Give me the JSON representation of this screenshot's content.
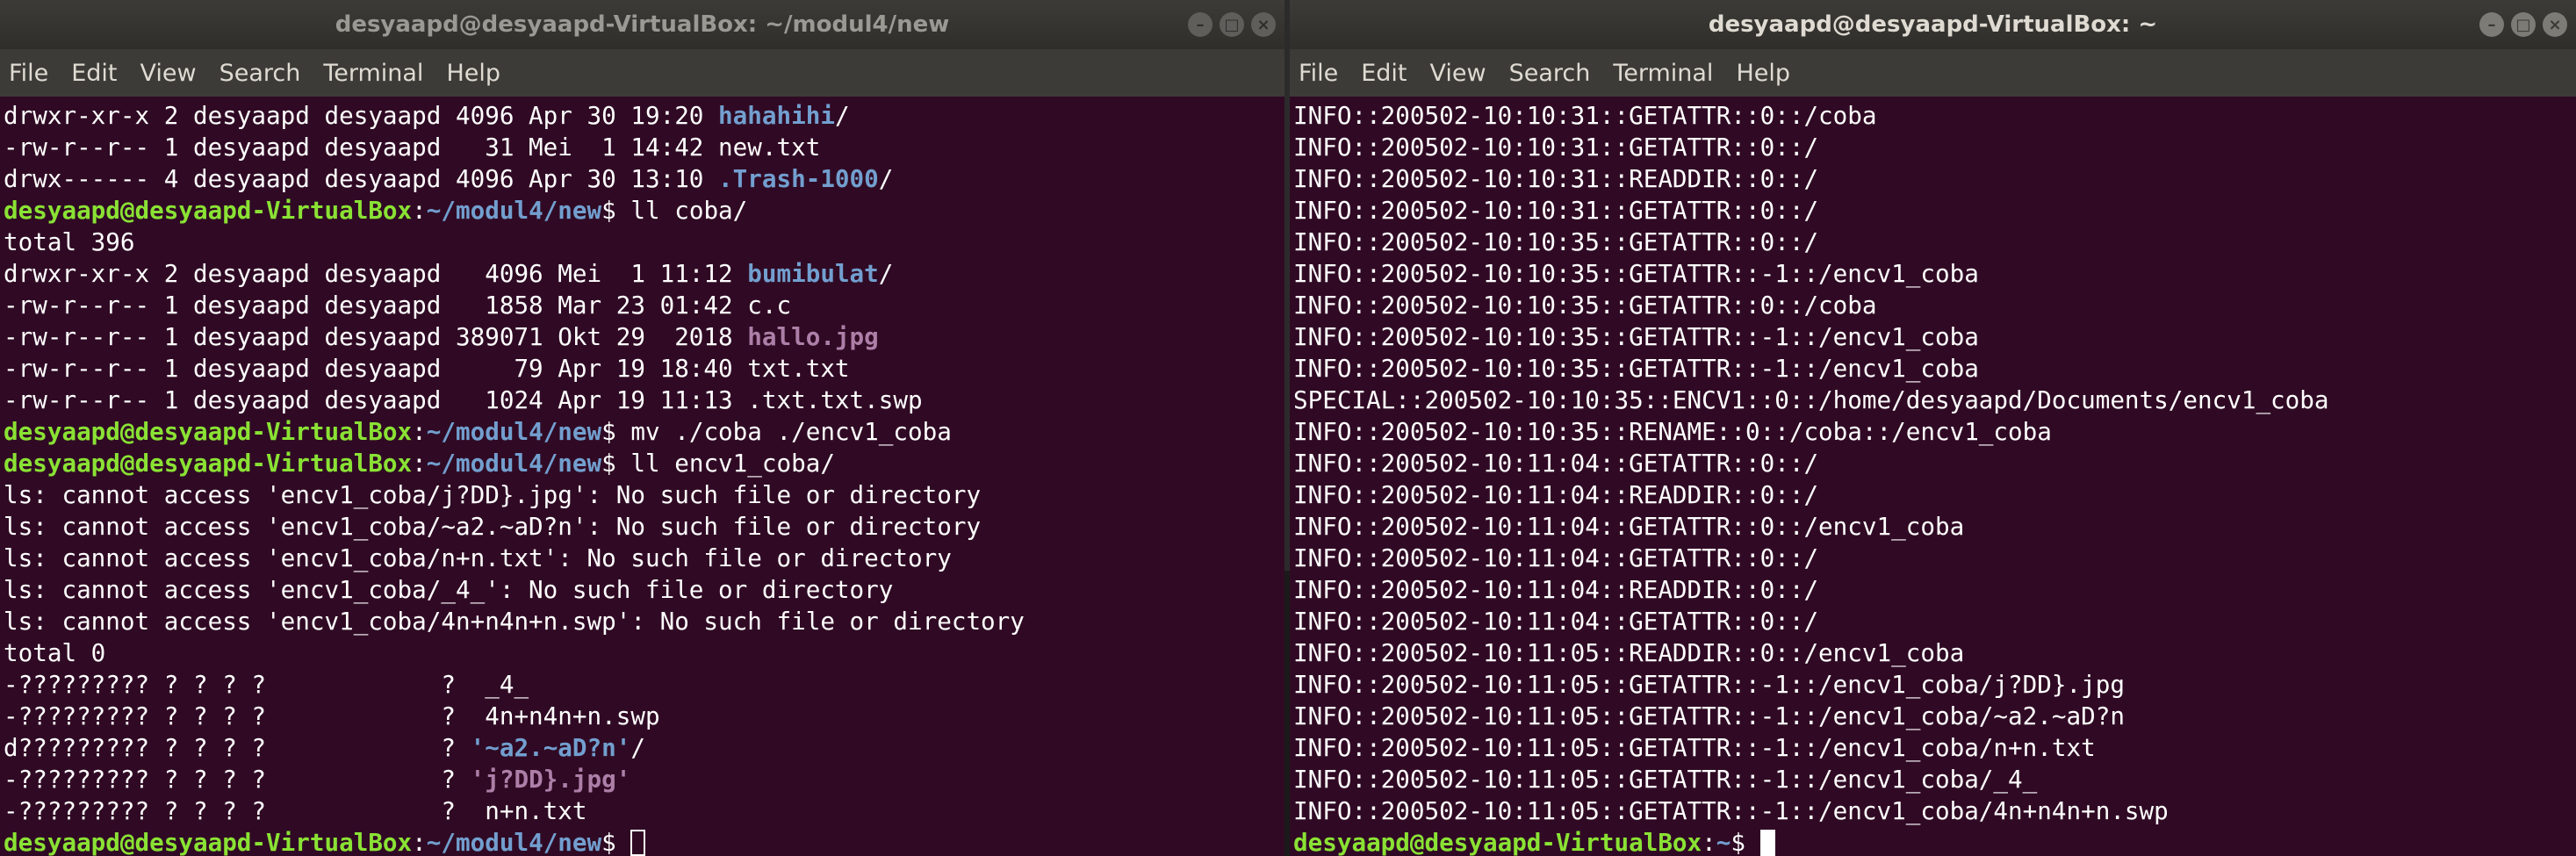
{
  "left": {
    "title": "desyaapd@desyaapd-VirtualBox: ~/modul4/new",
    "menu": [
      "File",
      "Edit",
      "View",
      "Search",
      "Terminal",
      "Help"
    ],
    "lines": [
      [
        [
          "drwxr-xr-x 2 desyaapd desyaapd 4096 Apr 30 19:20 ",
          ""
        ],
        [
          "hahahihi",
          "dir"
        ],
        [
          "/",
          ""
        ]
      ],
      [
        [
          "-rw-r--r-- 1 desyaapd desyaapd   31 Mei  1 14:42 new.txt",
          ""
        ]
      ],
      [
        [
          "drwx------ 4 desyaapd desyaapd 4096 Apr 30 13:10 ",
          ""
        ],
        [
          ".Trash-1000",
          "dir"
        ],
        [
          "/",
          ""
        ]
      ],
      [
        [
          "desyaapd@desyaapd-VirtualBox",
          "pu"
        ],
        [
          ":",
          ""
        ],
        [
          "~/modul4/new",
          "pp"
        ],
        [
          "$ ll coba/",
          ""
        ]
      ],
      [
        [
          "total 396",
          ""
        ]
      ],
      [
        [
          "drwxr-xr-x 2 desyaapd desyaapd   4096 Mei  1 11:12 ",
          ""
        ],
        [
          "bumibulat",
          "dir"
        ],
        [
          "/",
          ""
        ]
      ],
      [
        [
          "-rw-r--r-- 1 desyaapd desyaapd   1858 Mar 23 01:42 c.c",
          ""
        ]
      ],
      [
        [
          "-rw-r--r-- 1 desyaapd desyaapd 389071 Okt 29  2018 ",
          ""
        ],
        [
          "hallo.jpg",
          "img"
        ]
      ],
      [
        [
          "-rw-r--r-- 1 desyaapd desyaapd     79 Apr 19 18:40 txt.txt",
          ""
        ]
      ],
      [
        [
          "-rw-r--r-- 1 desyaapd desyaapd   1024 Apr 19 11:13 .txt.txt.swp",
          ""
        ]
      ],
      [
        [
          "desyaapd@desyaapd-VirtualBox",
          "pu"
        ],
        [
          ":",
          ""
        ],
        [
          "~/modul4/new",
          "pp"
        ],
        [
          "$ mv ./coba ./encv1_coba",
          ""
        ]
      ],
      [
        [
          "desyaapd@desyaapd-VirtualBox",
          "pu"
        ],
        [
          ":",
          ""
        ],
        [
          "~/modul4/new",
          "pp"
        ],
        [
          "$ ll encv1_coba/",
          ""
        ]
      ],
      [
        [
          "ls: cannot access 'encv1_coba/j?DD}.jpg': No such file or directory",
          ""
        ]
      ],
      [
        [
          "ls: cannot access 'encv1_coba/~a2.~aD?n': No such file or directory",
          ""
        ]
      ],
      [
        [
          "ls: cannot access 'encv1_coba/n+n.txt': No such file or directory",
          ""
        ]
      ],
      [
        [
          "ls: cannot access 'encv1_coba/_4_': No such file or directory",
          ""
        ]
      ],
      [
        [
          "ls: cannot access 'encv1_coba/4n+n4n+n.swp': No such file or directory",
          ""
        ]
      ],
      [
        [
          "total 0",
          ""
        ]
      ],
      [
        [
          "-????????? ? ? ? ?            ?  _4_",
          ""
        ]
      ],
      [
        [
          "-????????? ? ? ? ?            ?  4n+n4n+n.swp",
          ""
        ]
      ],
      [
        [
          "d????????? ? ? ? ?            ? ",
          ""
        ],
        [
          "'~a2.~aD?n'",
          "dir"
        ],
        [
          "/",
          ""
        ]
      ],
      [
        [
          "-????????? ? ? ? ?            ? ",
          ""
        ],
        [
          "'j?DD}.jpg'",
          "img"
        ]
      ],
      [
        [
          "-????????? ? ? ? ?            ?  n+n.txt",
          ""
        ]
      ],
      [
        [
          "desyaapd@desyaapd-VirtualBox",
          "pu"
        ],
        [
          ":",
          ""
        ],
        [
          "~/modul4/new",
          "pp"
        ],
        [
          "$ ",
          ""
        ]
      ]
    ]
  },
  "right": {
    "title": "desyaapd@desyaapd-VirtualBox: ~",
    "menu": [
      "File",
      "Edit",
      "View",
      "Search",
      "Terminal",
      "Help"
    ],
    "lines": [
      [
        [
          "INFO::200502-10:10:31::GETATTR::0::/coba",
          ""
        ]
      ],
      [
        [
          "INFO::200502-10:10:31::GETATTR::0::/",
          ""
        ]
      ],
      [
        [
          "INFO::200502-10:10:31::READDIR::0::/",
          ""
        ]
      ],
      [
        [
          "INFO::200502-10:10:31::GETATTR::0::/",
          ""
        ]
      ],
      [
        [
          "INFO::200502-10:10:35::GETATTR::0::/",
          ""
        ]
      ],
      [
        [
          "INFO::200502-10:10:35::GETATTR::-1::/encv1_coba",
          ""
        ]
      ],
      [
        [
          "INFO::200502-10:10:35::GETATTR::0::/coba",
          ""
        ]
      ],
      [
        [
          "INFO::200502-10:10:35::GETATTR::-1::/encv1_coba",
          ""
        ]
      ],
      [
        [
          "INFO::200502-10:10:35::GETATTR::-1::/encv1_coba",
          ""
        ]
      ],
      [
        [
          "SPECIAL::200502-10:10:35::ENCV1::0::/home/desyaapd/Documents/encv1_coba",
          ""
        ]
      ],
      [
        [
          "INFO::200502-10:10:35::RENAME::0::/coba::/encv1_coba",
          ""
        ]
      ],
      [
        [
          "INFO::200502-10:11:04::GETATTR::0::/",
          ""
        ]
      ],
      [
        [
          "INFO::200502-10:11:04::READDIR::0::/",
          ""
        ]
      ],
      [
        [
          "INFO::200502-10:11:04::GETATTR::0::/encv1_coba",
          ""
        ]
      ],
      [
        [
          "INFO::200502-10:11:04::GETATTR::0::/",
          ""
        ]
      ],
      [
        [
          "INFO::200502-10:11:04::READDIR::0::/",
          ""
        ]
      ],
      [
        [
          "INFO::200502-10:11:04::GETATTR::0::/",
          ""
        ]
      ],
      [
        [
          "INFO::200502-10:11:05::READDIR::0::/encv1_coba",
          ""
        ]
      ],
      [
        [
          "INFO::200502-10:11:05::GETATTR::-1::/encv1_coba/j?DD}.jpg",
          ""
        ]
      ],
      [
        [
          "INFO::200502-10:11:05::GETATTR::-1::/encv1_coba/~a2.~aD?n",
          ""
        ]
      ],
      [
        [
          "INFO::200502-10:11:05::GETATTR::-1::/encv1_coba/n+n.txt",
          ""
        ]
      ],
      [
        [
          "INFO::200502-10:11:05::GETATTR::-1::/encv1_coba/_4_",
          ""
        ]
      ],
      [
        [
          "INFO::200502-10:11:05::GETATTR::-1::/encv1_coba/4n+n4n+n.swp",
          ""
        ]
      ],
      [
        [
          "desyaapd@desyaapd-VirtualBox",
          "pu"
        ],
        [
          ":",
          ""
        ],
        [
          "~",
          "pp"
        ],
        [
          "$ ",
          ""
        ]
      ]
    ]
  }
}
